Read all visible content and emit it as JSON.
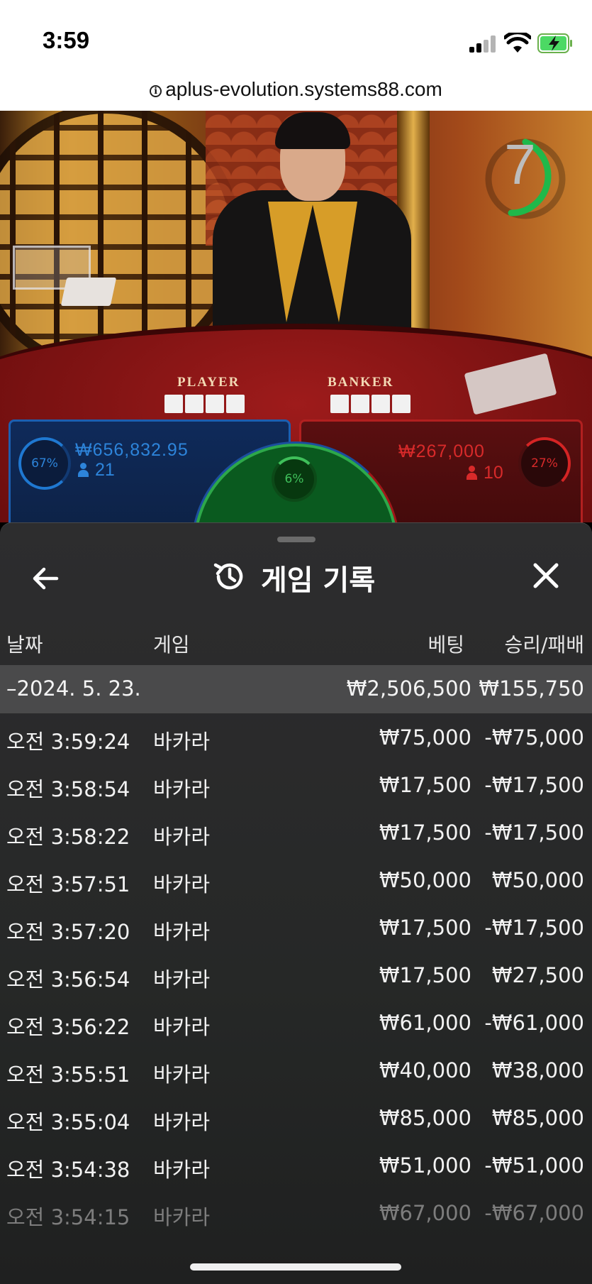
{
  "status_bar": {
    "time": "3:59"
  },
  "browser": {
    "url": "aplus-evolution.systems88.com"
  },
  "game_view": {
    "timer": "7",
    "table_labels": {
      "player": "PLAYER",
      "banker": "BANKER"
    },
    "player": {
      "percent": "67%",
      "amount": "₩656,832.95",
      "players": "21",
      "color": "#2d84da"
    },
    "tie": {
      "percent": "6%",
      "color": "#3fbf5a"
    },
    "banker": {
      "percent": "27%",
      "amount": "₩267,000",
      "players": "10",
      "color": "#d82a2a"
    }
  },
  "history": {
    "title": "게임 기록",
    "columns": {
      "date": "날짜",
      "game": "게임",
      "bet": "베팅",
      "result": "승리/패배"
    },
    "date_group": {
      "label": "–2024. 5. 23.",
      "total_bet": "₩2,506,500",
      "total_result": "₩155,750"
    },
    "rows": [
      {
        "time": "오전 3:59:24",
        "game": "바카라",
        "bet": "₩75,000",
        "result": "-₩75,000"
      },
      {
        "time": "오전 3:58:54",
        "game": "바카라",
        "bet": "₩17,500",
        "result": "-₩17,500"
      },
      {
        "time": "오전 3:58:22",
        "game": "바카라",
        "bet": "₩17,500",
        "result": "-₩17,500"
      },
      {
        "time": "오전 3:57:51",
        "game": "바카라",
        "bet": "₩50,000",
        "result": "₩50,000"
      },
      {
        "time": "오전 3:57:20",
        "game": "바카라",
        "bet": "₩17,500",
        "result": "-₩17,500"
      },
      {
        "time": "오전 3:56:54",
        "game": "바카라",
        "bet": "₩17,500",
        "result": "₩27,500"
      },
      {
        "time": "오전 3:56:22",
        "game": "바카라",
        "bet": "₩61,000",
        "result": "-₩61,000"
      },
      {
        "time": "오전 3:55:51",
        "game": "바카라",
        "bet": "₩40,000",
        "result": "₩38,000"
      },
      {
        "time": "오전 3:55:04",
        "game": "바카라",
        "bet": "₩85,000",
        "result": "₩85,000"
      },
      {
        "time": "오전 3:54:38",
        "game": "바카라",
        "bet": "₩51,000",
        "result": "-₩51,000"
      },
      {
        "time": "오전 3:54:15",
        "game": "바카라",
        "bet": "₩67,000",
        "result": "-₩67,000"
      }
    ]
  }
}
